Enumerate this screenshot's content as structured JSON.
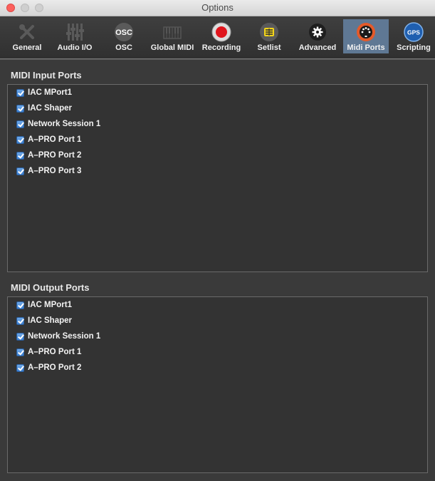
{
  "window": {
    "title": "Options"
  },
  "toolbar": {
    "tabs": [
      {
        "label": "General"
      },
      {
        "label": "Audio I/O"
      },
      {
        "label": "OSC",
        "icon_text": "OSC"
      },
      {
        "label": "Global MIDI"
      },
      {
        "label": "Recording"
      },
      {
        "label": "Setlist"
      },
      {
        "label": "Advanced"
      },
      {
        "label": "Midi Ports",
        "selected": true
      },
      {
        "label": "Scripting",
        "icon_text": "GPS"
      }
    ]
  },
  "input_ports": {
    "title": "MIDI Input Ports",
    "items": [
      {
        "label": "IAC MPort1",
        "checked": true
      },
      {
        "label": "IAC Shaper",
        "checked": true
      },
      {
        "label": "Network Session 1",
        "checked": true
      },
      {
        "label": "A–PRO Port 1",
        "checked": true
      },
      {
        "label": "A–PRO Port 2",
        "checked": true
      },
      {
        "label": "A–PRO Port 3",
        "checked": true
      }
    ]
  },
  "output_ports": {
    "title": "MIDI Output Ports",
    "items": [
      {
        "label": "IAC MPort1",
        "checked": true
      },
      {
        "label": "IAC Shaper",
        "checked": true
      },
      {
        "label": "Network Session 1",
        "checked": true
      },
      {
        "label": "A–PRO Port 1",
        "checked": true
      },
      {
        "label": "A–PRO Port 2",
        "checked": true
      }
    ]
  }
}
